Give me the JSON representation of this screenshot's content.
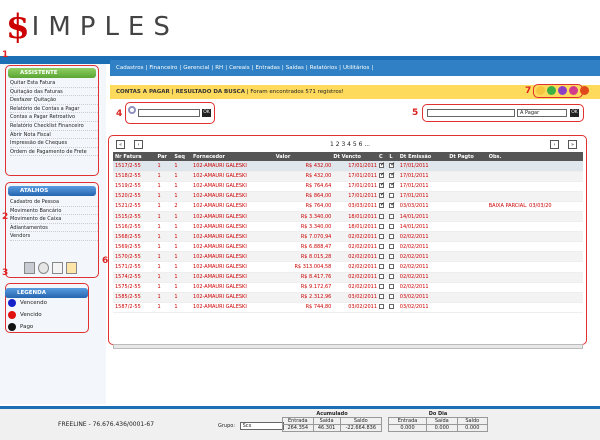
{
  "logo": {
    "mark": "$",
    "word": "IMPLES"
  },
  "nav": [
    "Cadastros",
    "|",
    "Financeiro",
    "|",
    "Gerencial",
    "|",
    "RH",
    "|",
    "Cereais",
    "|",
    "Entradas",
    "|",
    "Saídas",
    "|",
    "Relatórios",
    "|",
    "Utilitários",
    "|"
  ],
  "annotations": {
    "n1": "1",
    "n2": "2",
    "n3": "3",
    "n4": "4",
    "n5": "5",
    "n6": "6",
    "n7": "7"
  },
  "assistente": {
    "title": "ASSISTENTE",
    "items": [
      "Quitar Esta Fatura",
      "Quitação das Faturas",
      "Desfazer Quitação",
      "Relatório de Contas a Pagar",
      "Contas a Pagar Retroativo",
      "Relatório Checklist Financeiro",
      "Abrir Nota Fiscal",
      "Impressão de Cheques",
      "Ordem de Pagamento de Frete"
    ]
  },
  "atalhos": {
    "title": "ATALHOS",
    "items": [
      "Cadastro de Pessoa",
      "Movimento Bancário",
      "Movimento de Caixa",
      "Adiantamentos",
      "Vendors"
    ]
  },
  "legenda": {
    "title": "LEGENDA",
    "items": [
      {
        "label": "Vencendo",
        "color": "#1520c8"
      },
      {
        "label": "Vencido",
        "color": "#e01010"
      },
      {
        "label": "Pago",
        "color": "#111111"
      }
    ]
  },
  "header": {
    "title": "CONTAS A PAGAR | RESULTADO DA BUSCA",
    "subtitle": " | Foram encontrados 571 registros!"
  },
  "search": {
    "ok": "OK",
    "filter_value": "",
    "status_value": "A Pagar"
  },
  "pager": {
    "pages": "1 2 3 4 5 6 ..."
  },
  "columns": [
    "Nr Fatura",
    "Par",
    "Seq",
    "Fornecedor",
    "Valor",
    "Dt Vencto",
    "C",
    "L",
    "Dt Emissão",
    "Dt Pagto",
    "Obs."
  ],
  "rows": [
    {
      "nr": "1517/2-55",
      "par": "1",
      "seq": "1",
      "forn": "102-AMAURI GALESKI",
      "valor": "R$ 432,00",
      "venc": "17/01/2011",
      "c": true,
      "l": true,
      "emis": "17/01/2011",
      "pagto": "",
      "obs": ""
    },
    {
      "nr": "1518/2-55",
      "par": "1",
      "seq": "1",
      "forn": "102-AMAURI GALESKI",
      "valor": "R$ 432,00",
      "venc": "17/01/2011",
      "c": true,
      "l": true,
      "emis": "17/01/2011",
      "pagto": "",
      "obs": ""
    },
    {
      "nr": "1519/2-55",
      "par": "1",
      "seq": "1",
      "forn": "102-AMAURI GALESKI",
      "valor": "R$ 764,64",
      "venc": "17/01/2011",
      "c": true,
      "l": true,
      "emis": "17/01/2011",
      "pagto": "",
      "obs": ""
    },
    {
      "nr": "1520/2-55",
      "par": "1",
      "seq": "1",
      "forn": "102-AMAURI GALESKI",
      "valor": "R$ 864,00",
      "venc": "17/01/2011",
      "c": true,
      "l": false,
      "emis": "17/01/2011",
      "pagto": "",
      "obs": ""
    },
    {
      "nr": "1521/2-55",
      "par": "1",
      "seq": "2",
      "forn": "102-AMAURI GALESKI",
      "valor": "R$ 764,00",
      "venc": "03/03/2011",
      "c": true,
      "l": true,
      "emis": "03/03/2011",
      "pagto": "",
      "obs": "BAIXA PARCIAL. 03/03/20"
    },
    {
      "nr": "1515/2-55",
      "par": "1",
      "seq": "1",
      "forn": "102-AMAURI GALESKI",
      "valor": "R$ 3.340,00",
      "venc": "18/01/2011",
      "c": false,
      "l": false,
      "emis": "14/01/2011",
      "pagto": "",
      "obs": ""
    },
    {
      "nr": "1516/2-55",
      "par": "1",
      "seq": "1",
      "forn": "102-AMAURI GALESKI",
      "valor": "R$ 3.340,00",
      "venc": "18/01/2011",
      "c": false,
      "l": false,
      "emis": "14/01/2011",
      "pagto": "",
      "obs": ""
    },
    {
      "nr": "1568/2-55",
      "par": "1",
      "seq": "1",
      "forn": "102-AMAURI GALESKI",
      "valor": "R$ 7.070,94",
      "venc": "02/02/2011",
      "c": false,
      "l": false,
      "emis": "02/02/2011",
      "pagto": "",
      "obs": ""
    },
    {
      "nr": "1569/2-55",
      "par": "1",
      "seq": "1",
      "forn": "102-AMAURI GALESKI",
      "valor": "R$ 6.888,47",
      "venc": "02/02/2011",
      "c": false,
      "l": false,
      "emis": "02/02/2011",
      "pagto": "",
      "obs": ""
    },
    {
      "nr": "1570/2-55",
      "par": "1",
      "seq": "1",
      "forn": "102-AMAURI GALESKI",
      "valor": "R$ 8.015,28",
      "venc": "02/02/2011",
      "c": false,
      "l": false,
      "emis": "02/02/2011",
      "pagto": "",
      "obs": ""
    },
    {
      "nr": "1571/2-55",
      "par": "1",
      "seq": "1",
      "forn": "102-AMAURI GALESKI",
      "valor": "R$ 313.004,58",
      "venc": "02/02/2011",
      "c": false,
      "l": false,
      "emis": "02/02/2011",
      "pagto": "",
      "obs": ""
    },
    {
      "nr": "1574/2-55",
      "par": "1",
      "seq": "1",
      "forn": "102-AMAURI GALESKI",
      "valor": "R$ 8.417,76",
      "venc": "02/02/2011",
      "c": false,
      "l": false,
      "emis": "02/02/2011",
      "pagto": "",
      "obs": ""
    },
    {
      "nr": "1575/2-55",
      "par": "1",
      "seq": "1",
      "forn": "102-AMAURI GALESKI",
      "valor": "R$ 9.172,67",
      "venc": "02/02/2011",
      "c": false,
      "l": false,
      "emis": "02/02/2011",
      "pagto": "",
      "obs": ""
    },
    {
      "nr": "1585/2-55",
      "par": "1",
      "seq": "1",
      "forn": "102-AMAURI GALESKI",
      "valor": "R$ 2.312,96",
      "venc": "03/02/2011",
      "c": false,
      "l": false,
      "emis": "03/02/2011",
      "pagto": "",
      "obs": ""
    },
    {
      "nr": "1587/2-55",
      "par": "1",
      "seq": "1",
      "forn": "102-AMAURI GALESKI",
      "valor": "R$ 744,80",
      "venc": "03/02/2011",
      "c": false,
      "l": false,
      "emis": "03/02/2011",
      "pagto": "",
      "obs": ""
    }
  ],
  "footer": {
    "company": "FREELINE - 76.676.436/0001-67",
    "grupo_label": "Grupo:",
    "grupo_value": "Scx",
    "acumulado": {
      "title": "Acumulado",
      "h1": "Entrada",
      "h2": "Saída",
      "h3": "Saldo",
      "v1": "264.354",
      "v2": "46.301",
      "v3": "-22.664.836"
    },
    "dodia": {
      "title": "Do Dia",
      "h1": "Entrada",
      "h2": "Saída",
      "h3": "Saldo",
      "v1": "0.000",
      "v2": "0.000",
      "v3": "0.000"
    }
  }
}
